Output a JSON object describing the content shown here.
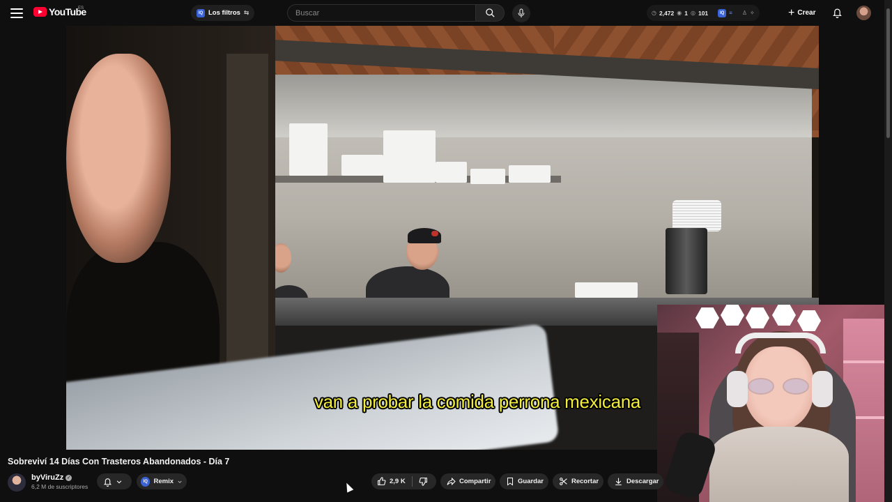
{
  "header": {
    "logo_text": "YouTube",
    "logo_region": "ES",
    "filters_label": "Los filtros",
    "filters_badge": "IQ",
    "search_placeholder": "Buscar",
    "stats": {
      "views": "2,472",
      "stat2": "1",
      "stat3": "101",
      "badge": "IQ"
    },
    "create_label": "Crear"
  },
  "video": {
    "subtitle": "van a probar la comida perrona mexicana"
  },
  "info": {
    "title": "Sobreviví 14 Días Con Trasteros Abandonados - Día 7",
    "channel_name": "byViruZz",
    "subscribers": "6,2 M de suscriptores",
    "remix_badge": "IQ",
    "remix_label": "Remix",
    "like_count": "2,9 K",
    "share_label": "Compartir",
    "save_label": "Guardar",
    "clip_label": "Recortar",
    "download_label": "Descargar"
  },
  "colors": {
    "accent": "#ff0033",
    "background": "#0f0f0f",
    "pill": "#272727",
    "subtitle": "#f2ec3a",
    "iq_badge": "#3b63d8"
  }
}
